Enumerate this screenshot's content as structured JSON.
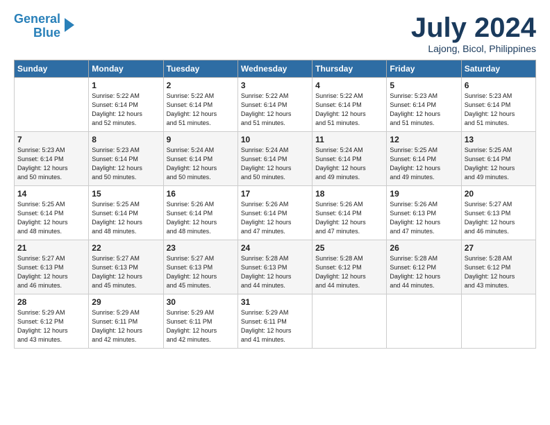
{
  "header": {
    "logo_line1": "General",
    "logo_line2": "Blue",
    "month_year": "July 2024",
    "location": "Lajong, Bicol, Philippines"
  },
  "days_of_week": [
    "Sunday",
    "Monday",
    "Tuesday",
    "Wednesday",
    "Thursday",
    "Friday",
    "Saturday"
  ],
  "weeks": [
    [
      {
        "day": "",
        "info": ""
      },
      {
        "day": "1",
        "info": "Sunrise: 5:22 AM\nSunset: 6:14 PM\nDaylight: 12 hours\nand 52 minutes."
      },
      {
        "day": "2",
        "info": "Sunrise: 5:22 AM\nSunset: 6:14 PM\nDaylight: 12 hours\nand 51 minutes."
      },
      {
        "day": "3",
        "info": "Sunrise: 5:22 AM\nSunset: 6:14 PM\nDaylight: 12 hours\nand 51 minutes."
      },
      {
        "day": "4",
        "info": "Sunrise: 5:22 AM\nSunset: 6:14 PM\nDaylight: 12 hours\nand 51 minutes."
      },
      {
        "day": "5",
        "info": "Sunrise: 5:23 AM\nSunset: 6:14 PM\nDaylight: 12 hours\nand 51 minutes."
      },
      {
        "day": "6",
        "info": "Sunrise: 5:23 AM\nSunset: 6:14 PM\nDaylight: 12 hours\nand 51 minutes."
      }
    ],
    [
      {
        "day": "7",
        "info": "Sunrise: 5:23 AM\nSunset: 6:14 PM\nDaylight: 12 hours\nand 50 minutes."
      },
      {
        "day": "8",
        "info": "Sunrise: 5:23 AM\nSunset: 6:14 PM\nDaylight: 12 hours\nand 50 minutes."
      },
      {
        "day": "9",
        "info": "Sunrise: 5:24 AM\nSunset: 6:14 PM\nDaylight: 12 hours\nand 50 minutes."
      },
      {
        "day": "10",
        "info": "Sunrise: 5:24 AM\nSunset: 6:14 PM\nDaylight: 12 hours\nand 50 minutes."
      },
      {
        "day": "11",
        "info": "Sunrise: 5:24 AM\nSunset: 6:14 PM\nDaylight: 12 hours\nand 49 minutes."
      },
      {
        "day": "12",
        "info": "Sunrise: 5:25 AM\nSunset: 6:14 PM\nDaylight: 12 hours\nand 49 minutes."
      },
      {
        "day": "13",
        "info": "Sunrise: 5:25 AM\nSunset: 6:14 PM\nDaylight: 12 hours\nand 49 minutes."
      }
    ],
    [
      {
        "day": "14",
        "info": "Sunrise: 5:25 AM\nSunset: 6:14 PM\nDaylight: 12 hours\nand 48 minutes."
      },
      {
        "day": "15",
        "info": "Sunrise: 5:25 AM\nSunset: 6:14 PM\nDaylight: 12 hours\nand 48 minutes."
      },
      {
        "day": "16",
        "info": "Sunrise: 5:26 AM\nSunset: 6:14 PM\nDaylight: 12 hours\nand 48 minutes."
      },
      {
        "day": "17",
        "info": "Sunrise: 5:26 AM\nSunset: 6:14 PM\nDaylight: 12 hours\nand 47 minutes."
      },
      {
        "day": "18",
        "info": "Sunrise: 5:26 AM\nSunset: 6:14 PM\nDaylight: 12 hours\nand 47 minutes."
      },
      {
        "day": "19",
        "info": "Sunrise: 5:26 AM\nSunset: 6:13 PM\nDaylight: 12 hours\nand 47 minutes."
      },
      {
        "day": "20",
        "info": "Sunrise: 5:27 AM\nSunset: 6:13 PM\nDaylight: 12 hours\nand 46 minutes."
      }
    ],
    [
      {
        "day": "21",
        "info": "Sunrise: 5:27 AM\nSunset: 6:13 PM\nDaylight: 12 hours\nand 46 minutes."
      },
      {
        "day": "22",
        "info": "Sunrise: 5:27 AM\nSunset: 6:13 PM\nDaylight: 12 hours\nand 45 minutes."
      },
      {
        "day": "23",
        "info": "Sunrise: 5:27 AM\nSunset: 6:13 PM\nDaylight: 12 hours\nand 45 minutes."
      },
      {
        "day": "24",
        "info": "Sunrise: 5:28 AM\nSunset: 6:13 PM\nDaylight: 12 hours\nand 44 minutes."
      },
      {
        "day": "25",
        "info": "Sunrise: 5:28 AM\nSunset: 6:12 PM\nDaylight: 12 hours\nand 44 minutes."
      },
      {
        "day": "26",
        "info": "Sunrise: 5:28 AM\nSunset: 6:12 PM\nDaylight: 12 hours\nand 44 minutes."
      },
      {
        "day": "27",
        "info": "Sunrise: 5:28 AM\nSunset: 6:12 PM\nDaylight: 12 hours\nand 43 minutes."
      }
    ],
    [
      {
        "day": "28",
        "info": "Sunrise: 5:29 AM\nSunset: 6:12 PM\nDaylight: 12 hours\nand 43 minutes."
      },
      {
        "day": "29",
        "info": "Sunrise: 5:29 AM\nSunset: 6:11 PM\nDaylight: 12 hours\nand 42 minutes."
      },
      {
        "day": "30",
        "info": "Sunrise: 5:29 AM\nSunset: 6:11 PM\nDaylight: 12 hours\nand 42 minutes."
      },
      {
        "day": "31",
        "info": "Sunrise: 5:29 AM\nSunset: 6:11 PM\nDaylight: 12 hours\nand 41 minutes."
      },
      {
        "day": "",
        "info": ""
      },
      {
        "day": "",
        "info": ""
      },
      {
        "day": "",
        "info": ""
      }
    ]
  ]
}
